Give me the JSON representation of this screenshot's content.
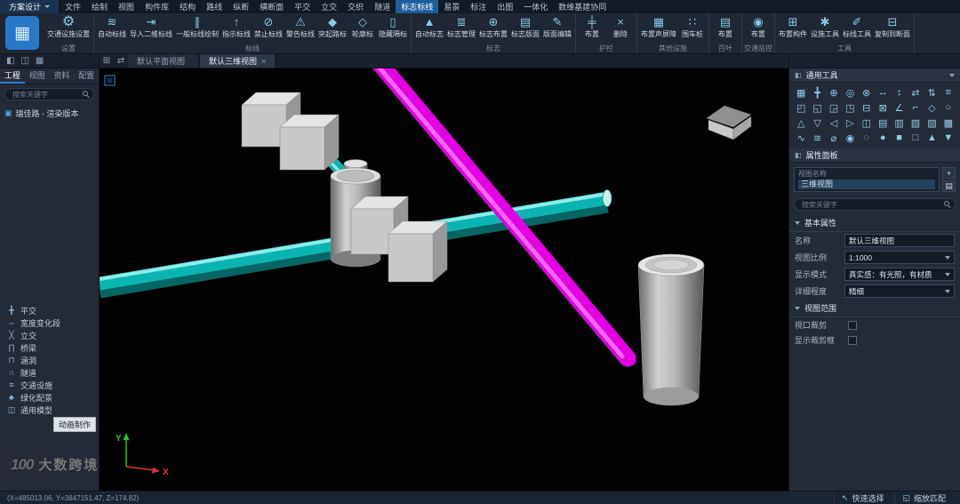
{
  "app": {
    "logo_glyph": "▦"
  },
  "colors": {
    "accent": "#2d7dd2",
    "selection_blue": "#1e5c9c",
    "magenta": "#e300e3",
    "cyan": "#0cb4b1"
  },
  "titlebar": {
    "app_menu": "方案设计",
    "tabs": [
      {
        "name": "menu-tab-file",
        "label": "文件"
      },
      {
        "name": "menu-tab-draw",
        "label": "绘制"
      },
      {
        "name": "menu-tab-view",
        "label": "视图"
      },
      {
        "name": "menu-tab-component-library",
        "label": "构件库"
      },
      {
        "name": "menu-tab-structure",
        "label": "结构"
      },
      {
        "name": "menu-tab-route",
        "label": "路线"
      },
      {
        "name": "menu-tab-profile",
        "label": "纵断"
      },
      {
        "name": "menu-tab-cross-section",
        "label": "横断面"
      },
      {
        "name": "menu-tab-at-grade",
        "label": "平交"
      },
      {
        "name": "menu-tab-interchange",
        "label": "立交"
      },
      {
        "name": "menu-tab-weaving",
        "label": "交织"
      },
      {
        "name": "menu-tab-tunnel",
        "label": "隧道"
      },
      {
        "name": "menu-tab-sign-marking",
        "label": "标志标线",
        "active": true
      },
      {
        "name": "menu-tab-yijing",
        "label": "易景"
      },
      {
        "name": "menu-tab-annotation",
        "label": "标注"
      },
      {
        "name": "menu-tab-output",
        "label": "出图"
      },
      {
        "name": "menu-tab-integration",
        "label": "一体化"
      },
      {
        "name": "menu-tab-shuwei-collaboration",
        "label": "数维基建协同"
      }
    ]
  },
  "ribbon": {
    "groups": [
      {
        "label": "设置",
        "buttons": [
          {
            "name": "traffic-facility-settings-button",
            "icon": "traffic-facility-settings-icon",
            "glyph": "⚙",
            "label": "交通设施设置"
          }
        ]
      },
      {
        "label": "标线",
        "buttons": [
          {
            "name": "auto-marking-button",
            "icon": "auto-marking-icon",
            "glyph": "≋",
            "label": "自动标线"
          },
          {
            "name": "import-2d-marking-button",
            "icon": "import-2d-marking-icon",
            "glyph": "⇥",
            "label": "导入二维标线"
          },
          {
            "name": "general-marking-draw-button",
            "icon": "general-marking-draw-icon",
            "glyph": "∥",
            "label": "一般标线绘制"
          },
          {
            "name": "guide-marking-button",
            "icon": "guide-marking-icon",
            "glyph": "↑",
            "label": "指示标线"
          },
          {
            "name": "prohibit-marking-button",
            "icon": "prohibit-marking-icon",
            "glyph": "⊘",
            "label": "禁止标线"
          },
          {
            "name": "warning-marking-button",
            "icon": "warning-marking-icon",
            "glyph": "⚠",
            "label": "警告标线"
          },
          {
            "name": "raised-marker-button",
            "icon": "raised-marker-icon",
            "glyph": "◆",
            "label": "突起路标"
          },
          {
            "name": "delineator-button",
            "icon": "delineator-icon",
            "glyph": "◇",
            "label": "轮廓标"
          },
          {
            "name": "hidden-divider-button",
            "icon": "hidden-divider-icon",
            "glyph": "▯",
            "label": "隐藏隔标"
          }
        ]
      },
      {
        "label": "标志",
        "buttons": [
          {
            "name": "auto-sign-button",
            "icon": "auto-sign-icon",
            "glyph": "▲",
            "label": "自动标志"
          },
          {
            "name": "sign-manage-button",
            "icon": "sign-manage-icon",
            "glyph": "≣",
            "label": "标志管理"
          },
          {
            "name": "sign-place-button",
            "icon": "sign-place-icon",
            "glyph": "⊕",
            "label": "标志布置"
          },
          {
            "name": "sign-panel-button",
            "icon": "sign-panel-icon",
            "glyph": "▤",
            "label": "标志版面"
          },
          {
            "name": "panel-edit-button",
            "icon": "panel-edit-icon",
            "glyph": "✎",
            "label": "版面编辑"
          }
        ]
      },
      {
        "label": "护栏",
        "buttons": [
          {
            "name": "guardrail-place-button",
            "icon": "guardrail-place-icon",
            "glyph": "╪",
            "label": "布置"
          },
          {
            "name": "guardrail-delete-button",
            "icon": "guardrail-delete-icon",
            "glyph": "×",
            "label": "删除"
          }
        ]
      },
      {
        "label": "其他设施",
        "buttons": [
          {
            "name": "sound-barrier-place-button",
            "icon": "sound-barrier-icon",
            "glyph": "▦",
            "label": "布置声屏障"
          },
          {
            "name": "bollard-place-button",
            "icon": "bollard-icon",
            "glyph": "∷",
            "label": "围车桩"
          }
        ]
      },
      {
        "label": "百叶",
        "buttons": [
          {
            "name": "louver-place-button",
            "icon": "louver-icon",
            "glyph": "▤",
            "label": "布置"
          }
        ]
      },
      {
        "label": "交通监控",
        "buttons": [
          {
            "name": "monitor-place-button",
            "icon": "monitor-icon",
            "glyph": "◉",
            "label": "布置"
          }
        ]
      },
      {
        "label": "工具",
        "buttons": [
          {
            "name": "component-place-button",
            "icon": "component-place-icon",
            "glyph": "⊞",
            "label": "布置构件"
          },
          {
            "name": "facility-tool-button",
            "icon": "facility-tool-icon",
            "glyph": "✱",
            "label": "设施工具"
          },
          {
            "name": "marking-tool-button",
            "icon": "marking-tool-icon",
            "glyph": "✐",
            "label": "标线工具"
          },
          {
            "name": "copy-to-section-button",
            "icon": "copy-to-section-icon",
            "glyph": "⊟",
            "label": "复制到断面"
          }
        ]
      }
    ]
  },
  "sidebar": {
    "mini_icons": [
      {
        "name": "panel-toggle-icon",
        "glyph": "◧"
      },
      {
        "name": "layout-columns-icon",
        "glyph": "◫"
      },
      {
        "name": "layout-grid-icon",
        "glyph": "▦"
      }
    ],
    "tabs": [
      {
        "name": "sidebar-tab-project",
        "label": "工程",
        "active": true
      },
      {
        "name": "sidebar-tab-view",
        "label": "视图"
      },
      {
        "name": "sidebar-tab-data",
        "label": "资料"
      },
      {
        "name": "sidebar-tab-config",
        "label": "配置"
      }
    ],
    "search_placeholder": "搜索关键字",
    "tree": [
      {
        "name": "tree-node-project",
        "glyph": "▣",
        "label": "瑞佳路 - 渲染版本"
      }
    ],
    "categories": [
      {
        "name": "category-at-grade",
        "glyph": "╋",
        "label": "平交"
      },
      {
        "name": "category-width-change",
        "glyph": "⇔",
        "label": "宽度变化段"
      },
      {
        "name": "category-interchange",
        "glyph": "╳",
        "label": "立交"
      },
      {
        "name": "category-bridge",
        "glyph": "∏",
        "label": "桥梁"
      },
      {
        "name": "category-culvert",
        "glyph": "⊓",
        "label": "涵洞"
      },
      {
        "name": "category-tunnel",
        "glyph": "∩",
        "label": "隧道"
      },
      {
        "name": "category-traffic-facility",
        "glyph": "≡",
        "label": "交通设施"
      },
      {
        "name": "category-greening",
        "glyph": "♣",
        "label": "绿化配景"
      },
      {
        "name": "category-generic-model",
        "glyph": "◫",
        "label": "通用模型"
      }
    ],
    "animation_label": "动画制作"
  },
  "doc_tabs": {
    "icons": [
      {
        "name": "views-grid-icon",
        "glyph": "⊞"
      },
      {
        "name": "swap-view-icon",
        "glyph": "⇄"
      }
    ],
    "tabs": [
      {
        "name": "tab-default-plan-view",
        "label": "默认平面视图"
      },
      {
        "name": "tab-default-3d-view",
        "label": "默认三维视图",
        "active": true,
        "close_glyph": "×"
      }
    ]
  },
  "viewport": {
    "axis": {
      "x_label": "X",
      "y_label": "Y"
    }
  },
  "watermark": {
    "logo_text": "100",
    "brand": "大数跨境"
  },
  "right_panel": {
    "tools_header": {
      "icon_glyph": "◧",
      "title": "通用工具"
    },
    "tool_icons": [
      "▦",
      "╋",
      "⊕",
      "◎",
      "⊗",
      "↔",
      "↕",
      "⇄",
      "⇅",
      "≡",
      "◰",
      "◱",
      "◲",
      "◳",
      "⊟",
      "⊠",
      "∠",
      "⌐",
      "◇",
      "○",
      "△",
      "▽",
      "◁",
      "▷",
      "◫",
      "▤",
      "▥",
      "▧",
      "▨",
      "▩",
      "∿",
      "≋",
      "⌀",
      "◉",
      "◌",
      "●",
      "■",
      "□",
      "▲",
      "▼"
    ],
    "properties_header": {
      "icon_glyph": "◧",
      "title": "属性面板"
    },
    "view_selector": {
      "label": "视图名称",
      "value": "三维视图",
      "add_glyph": "+",
      "list_glyph": "▤"
    },
    "search_placeholder": "搜索关键字",
    "basic_section": {
      "title": "基本属性"
    },
    "prop_rows": [
      {
        "name": "prop-name",
        "label": "名称",
        "value": "默认三维视图",
        "control": "input"
      },
      {
        "name": "prop-view-scale",
        "label": "视图比例",
        "value": "1:1000",
        "control": "select"
      },
      {
        "name": "prop-display-mode",
        "label": "显示模式",
        "value": "真实感：有光照，有材质",
        "control": "select"
      },
      {
        "name": "prop-detail-level",
        "label": "详细程度",
        "value": "精细",
        "control": "select"
      }
    ],
    "range_section": {
      "title": "视图范围"
    },
    "check_rows": [
      {
        "name": "viewport-crop-checkbox",
        "label": "视口裁剪"
      },
      {
        "name": "show-crop-box-checkbox",
        "label": "显示裁剪框"
      }
    ]
  },
  "statusbar": {
    "coordinates": "(X=485013.06, Y=3847151.47, Z=174.82)",
    "items": [
      {
        "name": "quick-select-button",
        "glyph": "↖",
        "label": "快速选择"
      },
      {
        "name": "zoom-fit-button",
        "glyph": "◱",
        "label": "缩放匹配"
      }
    ]
  }
}
